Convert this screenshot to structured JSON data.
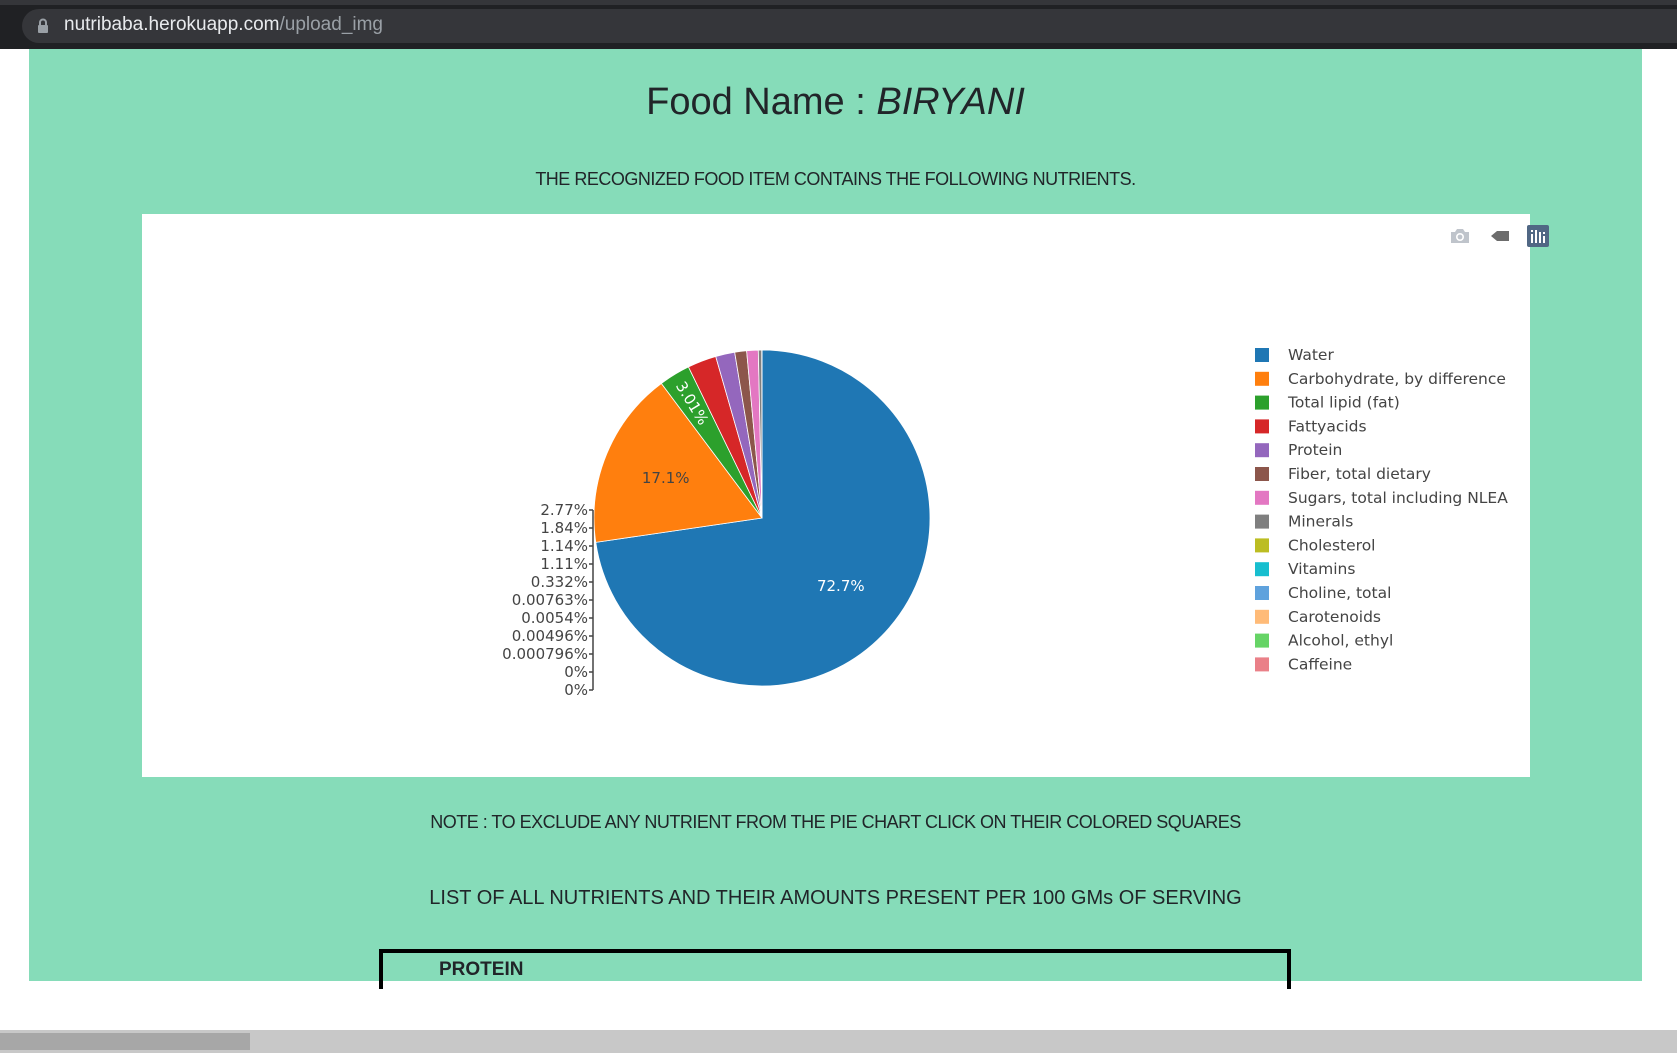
{
  "browser": {
    "url_host": "nutribaba.herokuapp.com",
    "url_path": "/upload_img"
  },
  "page": {
    "title_prefix": "Food Name : ",
    "food_name": "BIRYANI",
    "subtitle": "THE RECOGNIZED FOOD ITEM CONTAINS THE FOLLOWING NUTRIENTS.",
    "note": "NOTE : TO EXCLUDE ANY NUTRIENT FROM THE PIE CHART CLICK ON THEIR COLORED SQUARES",
    "list_heading": "LIST OF ALL NUTRIENTS AND THEIR AMOUNTS PRESENT PER 100 GMs OF SERVING",
    "table_first_header": "PROTEIN"
  },
  "modebar": {
    "icons": [
      "camera-icon",
      "eraser-icon",
      "plotly-logo-icon"
    ],
    "colors": {
      "inactive": "#bfc4cb",
      "active": "#506784"
    }
  },
  "chart_data": {
    "type": "pie",
    "categories": [
      "Water",
      "Carbohydrate, by difference",
      "Total lipid (fat)",
      "Fattyacids",
      "Protein",
      "Fiber, total dietary",
      "Sugars, total including NLEA",
      "Minerals",
      "Cholesterol",
      "Vitamins",
      "Choline, total",
      "Carotenoids",
      "Alcohol, ethyl",
      "Caffeine"
    ],
    "values": [
      72.7,
      17.1,
      3.01,
      2.77,
      1.84,
      1.14,
      1.11,
      0.332,
      0.00763,
      0.0054,
      0.00496,
      0.000796,
      0,
      0
    ],
    "labels": [
      "72.7%",
      "17.1%",
      "3.01%",
      "2.77%",
      "1.84%",
      "1.14%",
      "1.11%",
      "0.332%",
      "0.00763%",
      "0.0054%",
      "0.00496%",
      "0.000796%",
      "0%",
      "0%"
    ],
    "colors": [
      "#1f77b4",
      "#ff7f0e",
      "#2ca02c",
      "#d62728",
      "#9467bd",
      "#8c564b",
      "#e377c2",
      "#7f7f7f",
      "#bcbd22",
      "#17becf",
      "#5fa2dd",
      "#ffbb78",
      "#66d466",
      "#ea8088"
    ],
    "label_text_colors": [
      "#ffffff",
      "#444444",
      "#ffffff",
      "#ffffff"
    ],
    "legend_placement": "right",
    "outside_label_count": 11
  }
}
